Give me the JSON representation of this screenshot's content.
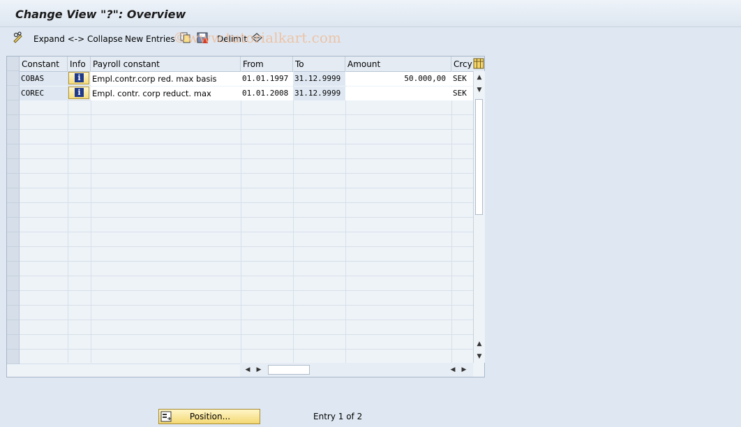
{
  "window": {
    "title": "Change View \"?\": Overview"
  },
  "toolbar": {
    "expand_collapse": "Expand <-> Collapse",
    "new_entries": "New Entries",
    "delimit": "Delimit"
  },
  "watermark": "©www.tutorialkart.com",
  "table": {
    "columns": [
      "Constant",
      "Info",
      "Payroll constant",
      "From",
      "To",
      "Amount",
      "Crcy"
    ],
    "rows": [
      {
        "constant": "COBAS",
        "payroll_constant": "Empl.contr.corp red. max basis",
        "from": "01.01.1997",
        "to": "31.12.9999",
        "amount": "50.000,00",
        "crcy": "SEK"
      },
      {
        "constant": "COREC",
        "payroll_constant": "Empl. contr. corp reduct. max",
        "from": "01.01.2008",
        "to": "31.12.9999",
        "amount": "",
        "crcy": "SEK"
      }
    ]
  },
  "footer": {
    "position_button": "Position...",
    "entry_info": "Entry 1 of 2"
  },
  "icons": {
    "info": "info-icon",
    "customize": "pencil-glasses-icon",
    "copy": "copy-icon",
    "save": "save-icon",
    "delimit": "delimit-icon",
    "compare": "compare-icon",
    "column_config": "table-settings-icon",
    "position": "position-icon"
  },
  "colors": {
    "accent_button": "#f4d873",
    "info_icon": "#1f3a8a",
    "watermark": "#f1b78e"
  }
}
